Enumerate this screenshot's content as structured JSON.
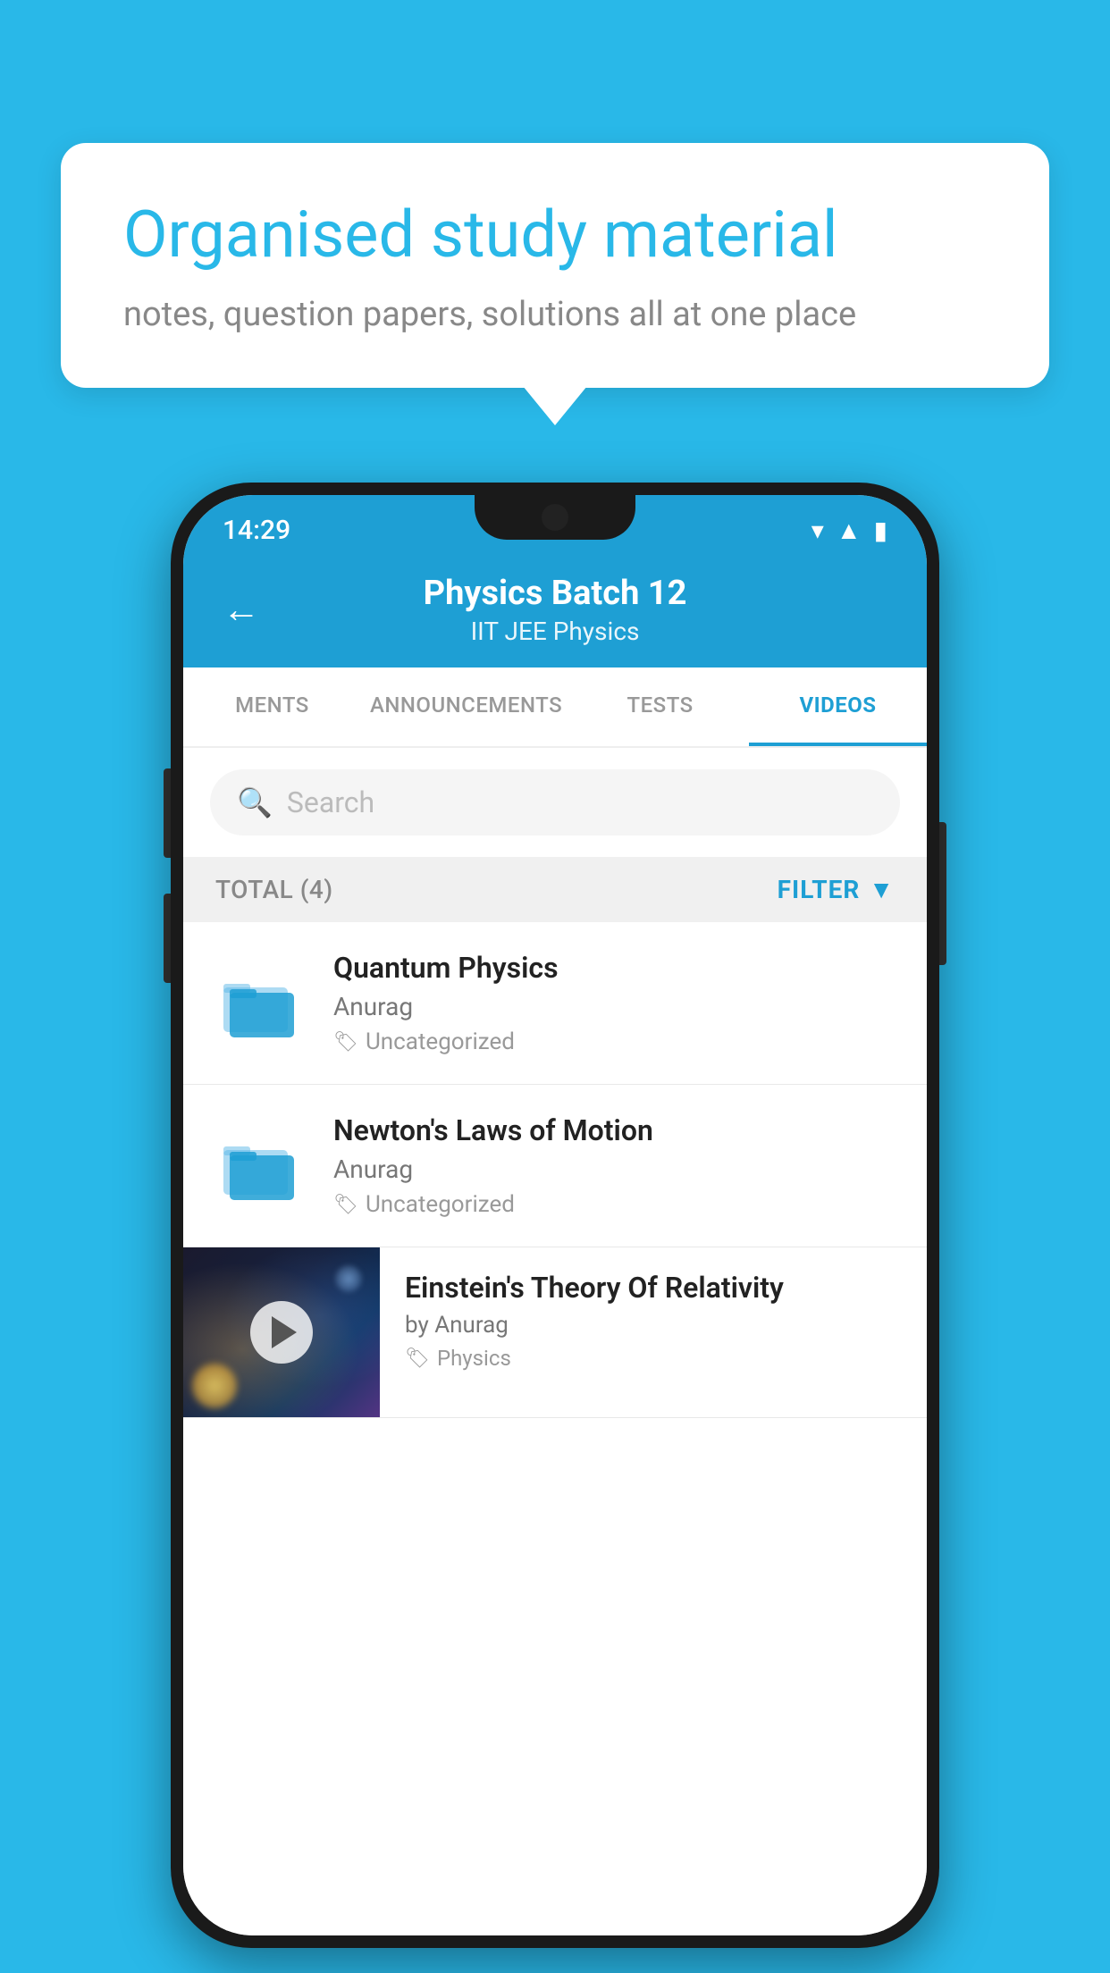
{
  "background": {
    "color": "#29b8e8"
  },
  "speech_bubble": {
    "title": "Organised study material",
    "subtitle": "notes, question papers, solutions all at one place"
  },
  "phone": {
    "status_bar": {
      "time": "14:29",
      "icons": [
        "wifi",
        "signal",
        "battery"
      ]
    },
    "header": {
      "back_label": "←",
      "title": "Physics Batch 12",
      "subtitle": "IIT JEE   Physics"
    },
    "tabs": [
      {
        "label": "MENTS",
        "active": false
      },
      {
        "label": "ANNOUNCEMENTS",
        "active": false
      },
      {
        "label": "TESTS",
        "active": false
      },
      {
        "label": "VIDEOS",
        "active": true
      }
    ],
    "search": {
      "placeholder": "Search"
    },
    "filter_bar": {
      "total_label": "TOTAL (4)",
      "filter_label": "FILTER"
    },
    "videos": [
      {
        "id": 1,
        "title": "Quantum Physics",
        "author": "Anurag",
        "tag": "Uncategorized",
        "type": "folder"
      },
      {
        "id": 2,
        "title": "Newton's Laws of Motion",
        "author": "Anurag",
        "tag": "Uncategorized",
        "type": "folder"
      },
      {
        "id": 3,
        "title": "Einstein's Theory Of Relativity",
        "author": "by Anurag",
        "tag": "Physics",
        "type": "video"
      }
    ]
  }
}
